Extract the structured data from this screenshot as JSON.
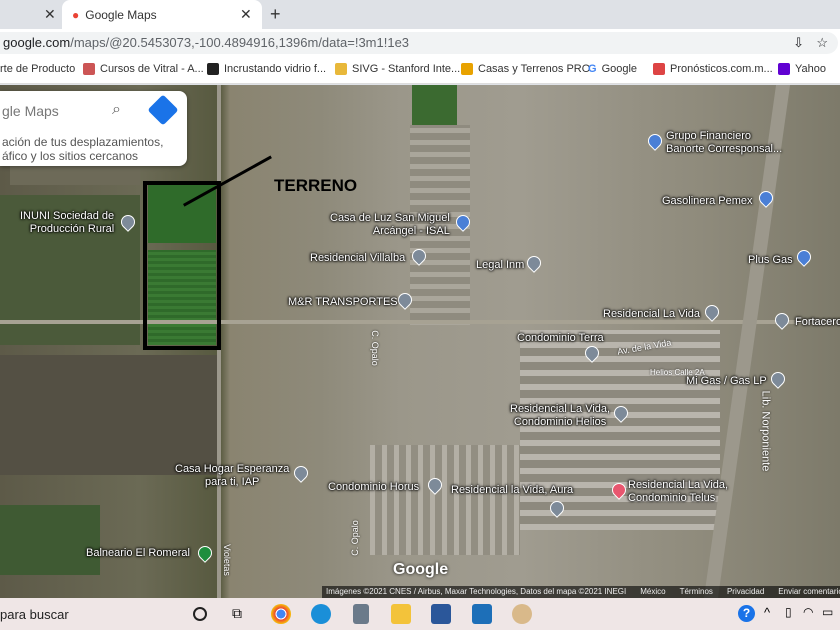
{
  "browser": {
    "tab_active": "Google Maps",
    "url_host": "google.com",
    "url_path": "/maps/@20.5453073,-100.4894916,1396m/data=!3m1!1e3",
    "bookmarks": [
      "rte de Producto",
      "Cursos de Vitral - A...",
      "Incrustando vidrio f...",
      "SIVG - Stanford Inte...",
      "Casas y Terrenos PRO",
      "Google",
      "Pronósticos.com.m...",
      "Yahoo"
    ]
  },
  "search": {
    "placeholder": "gle Maps",
    "sub1": "ación de tus desplazamientos,",
    "sub2": "áfico y los sitios cercanos"
  },
  "annotation": "TERRENO",
  "places": [
    {
      "l1": "INUNI Sociedad de",
      "l2": "Producción Rural"
    },
    {
      "l1": "Casa de Luz San Miguel",
      "l2": "Arcángel - ISAL"
    },
    {
      "l1": "Residencial Villalba"
    },
    {
      "l1": "Legal Inm"
    },
    {
      "l1": "M&R TRANSPORTES"
    },
    {
      "l1": "Grupo Financiero",
      "l2": "Banorte Corresponsal..."
    },
    {
      "l1": "Gasolinera Pemex"
    },
    {
      "l1": "Plus Gas"
    },
    {
      "l1": "Residencial La Vida"
    },
    {
      "l1": "Fortacero"
    },
    {
      "l1": "Condominio Terra"
    },
    {
      "l1": "Mi Gas / Gas LP"
    },
    {
      "l1": "Residencial La Vida,",
      "l2": "Condominio Helios"
    },
    {
      "l1": "Casa Hogar Esperanza",
      "l2": "para ti, IAP"
    },
    {
      "l1": "Condominio Horus"
    },
    {
      "l1": "Residencial la Vida, Aura"
    },
    {
      "l1": "Residencial La Vida,",
      "l2": "Condominio Telus"
    },
    {
      "l1": "Balneario El Romeral"
    }
  ],
  "roads": [
    "Lib. Norponiente",
    "C. Opalo",
    "C. Opalo",
    "Violetas",
    "Av. de la Vida",
    "Helios Calle 2A"
  ],
  "logo": "Google",
  "attribution": [
    "Imágenes ©2021 CNES / Airbus, Maxar Technologies, Datos del mapa ©2021 INEGI",
    "México",
    "Términos",
    "Privacidad",
    "Enviar comentarios"
  ],
  "taskbar": {
    "search": "para buscar"
  }
}
